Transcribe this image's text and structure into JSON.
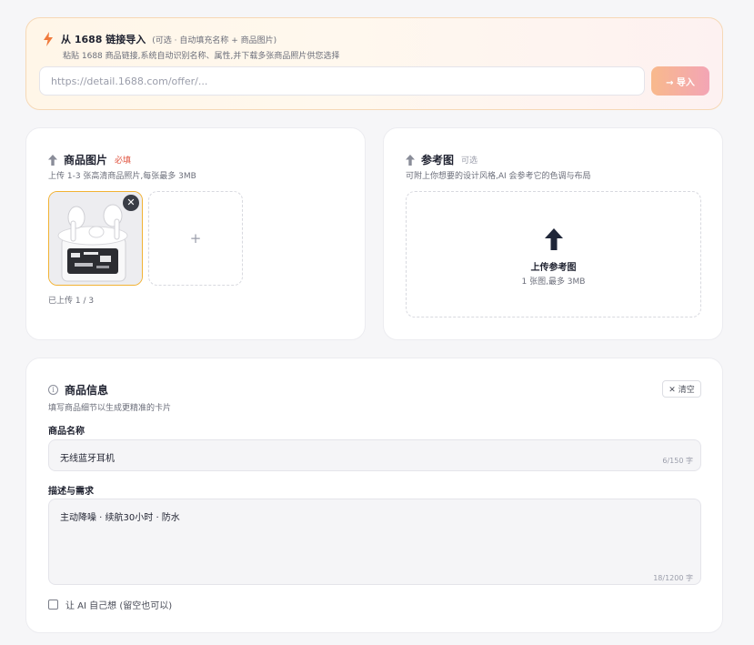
{
  "import": {
    "title": "从 1688 链接导入",
    "hint": "(可选 · 自动填充名称 + 商品图片)",
    "subtitle": "粘贴 1688 商品链接,系统自动识别名称、属性,并下载多张商品照片供您选择",
    "placeholder": "https://detail.1688.com/offer/...",
    "button_label": "→ 导入",
    "icon": "lightning-icon",
    "accent_color": "#f07a3c"
  },
  "product_images": {
    "title": "商品图片",
    "required_tag": "必填",
    "subtitle": "上传 1-3 张高清商品照片,每张最多 3MB",
    "remove_symbol": "✕",
    "add_symbol": "+",
    "upload_count": "已上传 1 / 3",
    "icon": "upload-arrow-icon",
    "thumbnail_subject": "earbuds-product-photo"
  },
  "reference": {
    "title": "参考图",
    "optional_tag": "可选",
    "subtitle": "可附上你想要的设计风格,AI 会参考它的色调与布局",
    "upload_label": "上传参考图",
    "upload_hint": "1 张图,最多 3MB",
    "icon": "upload-arrow-icon"
  },
  "product_info": {
    "icon_symbol": "i",
    "title": "商品信息",
    "subtitle": "填写商品细节以生成更精准的卡片",
    "clear_label": "✕ 清空",
    "name_label": "商品名称",
    "name_value": "无线蓝牙耳机",
    "name_counter": "6/150 字",
    "desc_label": "描述与需求",
    "desc_value": "主动降噪 · 续航30小时 · 防水",
    "desc_counter": "18/1200 字",
    "ai_checkbox_label": "让 AI 自己想 (留空也可以)",
    "ai_checked": false
  }
}
